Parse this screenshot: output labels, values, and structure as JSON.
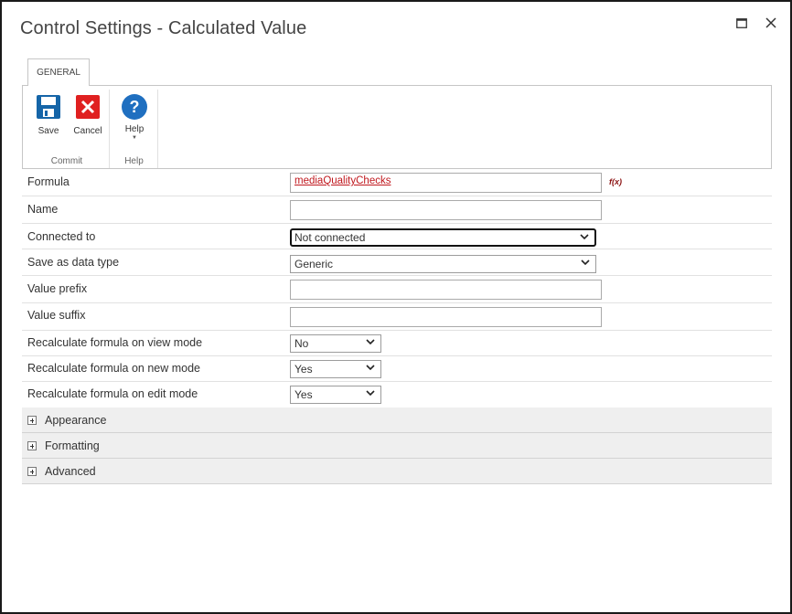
{
  "window": {
    "title": "Control Settings - Calculated Value"
  },
  "ribbon": {
    "tab_label": "GENERAL",
    "groups": {
      "commit": {
        "label": "Commit",
        "save_label": "Save",
        "cancel_label": "Cancel"
      },
      "help": {
        "label": "Help",
        "help_label": "Help"
      }
    }
  },
  "form": {
    "formula": {
      "label": "Formula",
      "value": "mediaQualityChecks"
    },
    "name": {
      "label": "Name",
      "value": ""
    },
    "connected_to": {
      "label": "Connected to",
      "selected": "Not connected"
    },
    "save_as_data_type": {
      "label": "Save as data type",
      "selected": "Generic"
    },
    "value_prefix": {
      "label": "Value prefix",
      "value": ""
    },
    "value_suffix": {
      "label": "Value suffix",
      "value": ""
    },
    "recalc_view": {
      "label": "Recalculate formula on view mode",
      "selected": "No"
    },
    "recalc_new": {
      "label": "Recalculate formula on new mode",
      "selected": "Yes"
    },
    "recalc_edit": {
      "label": "Recalculate formula on edit mode",
      "selected": "Yes"
    }
  },
  "sections": {
    "appearance": "Appearance",
    "formatting": "Formatting",
    "advanced": "Advanced"
  },
  "colors": {
    "save_icon": "#1565a8",
    "cancel_icon": "#e02020",
    "help_icon": "#1f6fc0",
    "formula_link": "#c0181e"
  }
}
